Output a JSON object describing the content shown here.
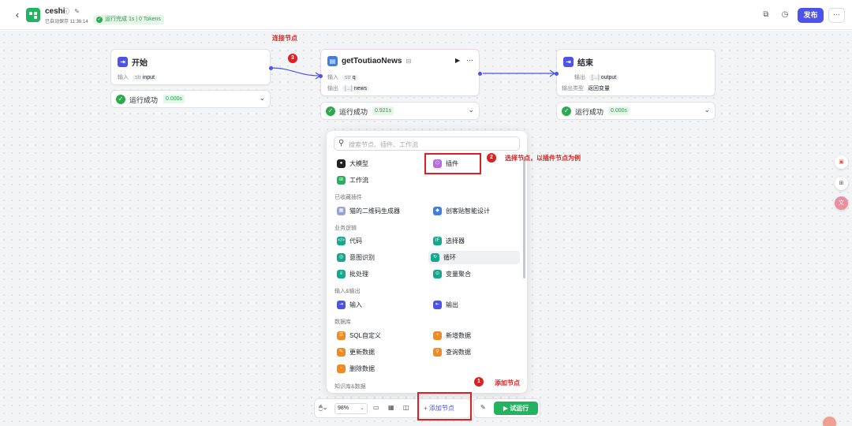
{
  "header": {
    "back_icon": "chevron-left-icon",
    "app_name": "ceshi",
    "autosave": "已自动保存 11:36:14",
    "run_status": "运行完成 1s | 0 Tokens",
    "publish_label": "发布",
    "more_label": "···"
  },
  "nodes": {
    "start": {
      "title": "开始",
      "io_label": "输入",
      "io_type": "str",
      "io_value": "input",
      "status": "运行成功",
      "time": "0.000s"
    },
    "plugin": {
      "title": "getToutiaoNews",
      "run_icon": "▶",
      "more_icon": "···",
      "in_label": "输入",
      "in_type": "str",
      "in_value": "q",
      "out_label": "输出",
      "out_type": "[...]",
      "out_value": "news",
      "status": "运行成功",
      "time": "0.921s"
    },
    "end": {
      "title": "结束",
      "out_label": "输出",
      "out_type": "[...]",
      "out_value": "output",
      "type_label": "输出类型",
      "type_value": "返回变量",
      "status": "运行成功",
      "time": "0.000s"
    }
  },
  "annotations": {
    "connect": "连接节点",
    "n3": "3",
    "select": "选择节点，以插件节点为例",
    "n2": "2",
    "add": "添加节点",
    "n1": "1"
  },
  "panel": {
    "search_placeholder": "搜索节点、插件、工作流",
    "llm": "大模型",
    "plugin": "插件",
    "workflow": "工作流",
    "fav_section": "已收藏插件",
    "fav1": "猫的二维码生成器",
    "fav2": "创客贴智能设计",
    "logic_section": "业务逻辑",
    "code": "代码",
    "selector": "选择器",
    "intent": "意图识别",
    "loop": "循环",
    "batch": "批处理",
    "var_agg": "变量聚合",
    "io_section": "输入&输出",
    "input": "输入",
    "output": "输出",
    "db_section": "数据库",
    "sql": "SQL自定义",
    "insert": "新增数据",
    "update": "更新数据",
    "query": "查询数据",
    "delete": "删除数据",
    "kb_section": "知识库&数据"
  },
  "toolbar": {
    "zoom": "98%",
    "add_node": "+ 添加节点",
    "test_run": "▶ 试运行"
  },
  "colors": {
    "accent": "#4d53e8",
    "success": "#22b35e",
    "annotation": "#e02020"
  }
}
